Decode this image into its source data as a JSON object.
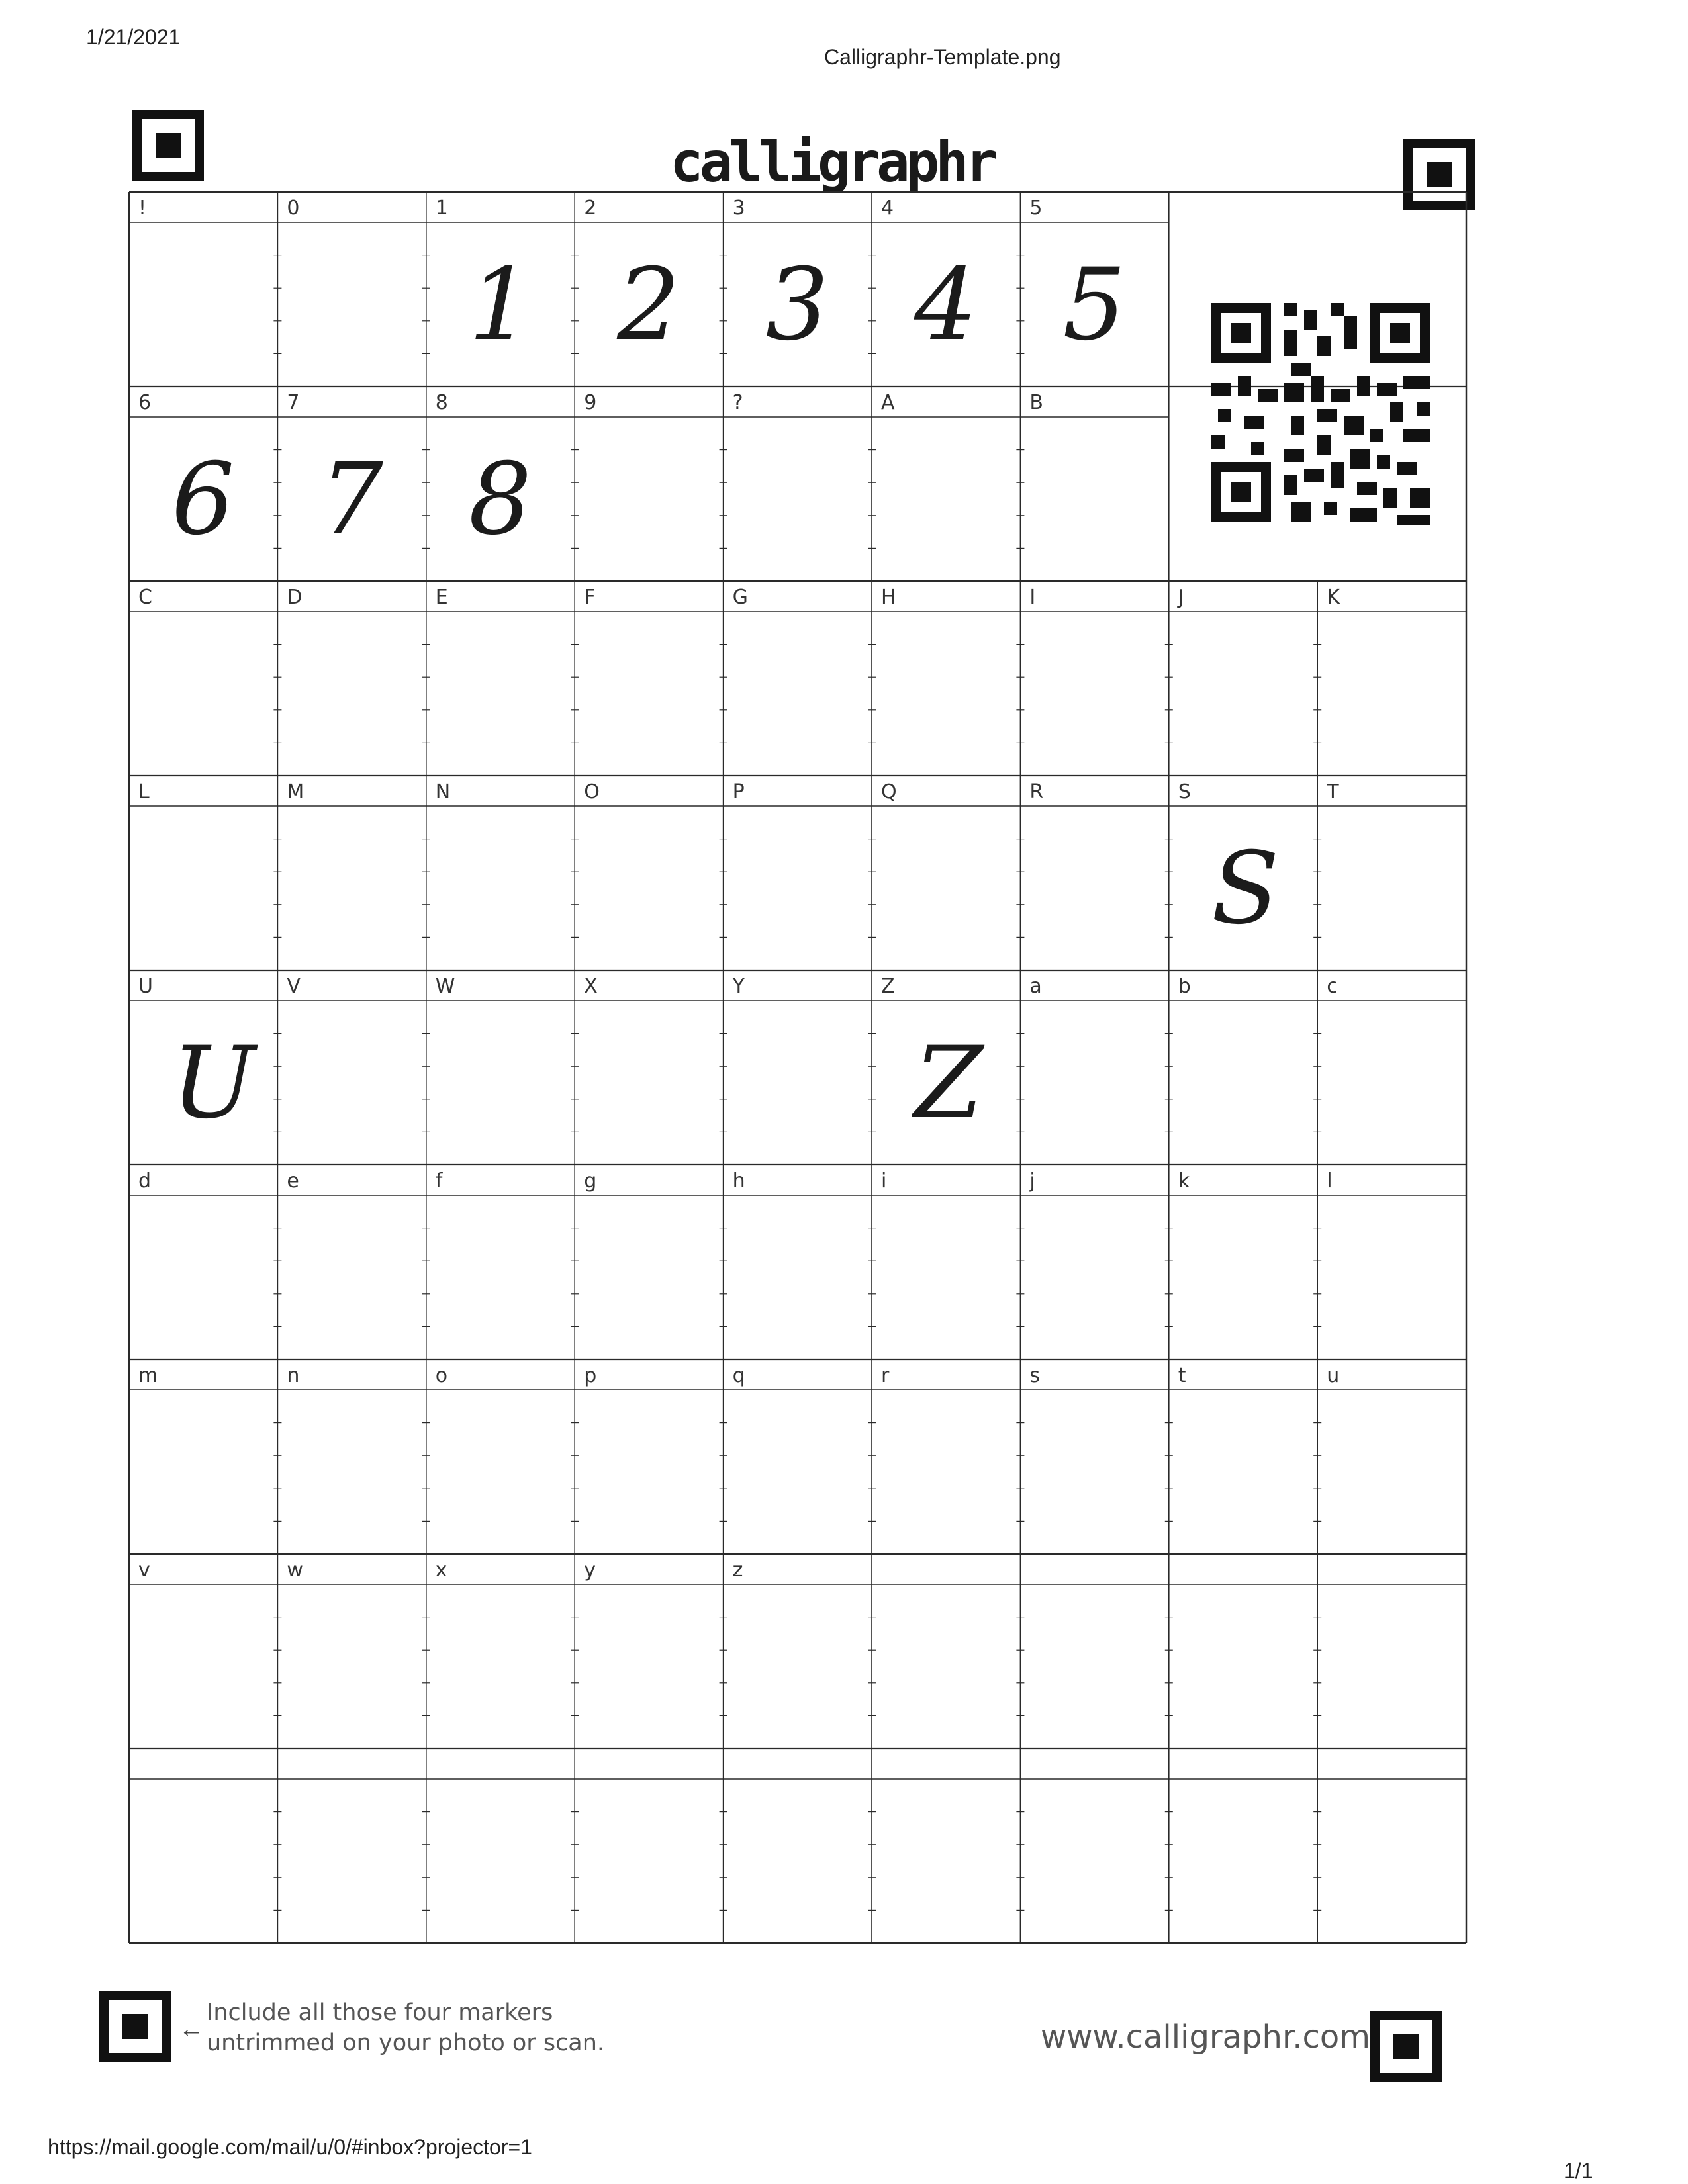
{
  "print_header": {
    "date": "1/21/2021",
    "title": "Calligraphr-Template.png",
    "url": "https://mail.google.com/mail/u/0/#inbox?projector=1",
    "page_count": "1/1"
  },
  "template": {
    "logo_text": "calligraphr",
    "rows": [
      {
        "cells": [
          {
            "label": "!",
            "glyph": ""
          },
          {
            "label": "0",
            "glyph": ""
          },
          {
            "label": "1",
            "glyph": "1"
          },
          {
            "label": "2",
            "glyph": "2"
          },
          {
            "label": "3",
            "glyph": "3"
          },
          {
            "label": "4",
            "glyph": "4"
          },
          {
            "label": "5",
            "glyph": "5"
          }
        ]
      },
      {
        "cells": [
          {
            "label": "6",
            "glyph": "6"
          },
          {
            "label": "7",
            "glyph": "7"
          },
          {
            "label": "8",
            "glyph": "8"
          },
          {
            "label": "9",
            "glyph": ""
          },
          {
            "label": "?",
            "glyph": ""
          },
          {
            "label": "A",
            "glyph": ""
          },
          {
            "label": "B",
            "glyph": ""
          }
        ]
      },
      {
        "cells": [
          {
            "label": "C",
            "glyph": ""
          },
          {
            "label": "D",
            "glyph": ""
          },
          {
            "label": "E",
            "glyph": ""
          },
          {
            "label": "F",
            "glyph": ""
          },
          {
            "label": "G",
            "glyph": ""
          },
          {
            "label": "H",
            "glyph": ""
          },
          {
            "label": "I",
            "glyph": ""
          },
          {
            "label": "J",
            "glyph": ""
          },
          {
            "label": "K",
            "glyph": ""
          }
        ]
      },
      {
        "cells": [
          {
            "label": "L",
            "glyph": ""
          },
          {
            "label": "M",
            "glyph": ""
          },
          {
            "label": "N",
            "glyph": ""
          },
          {
            "label": "O",
            "glyph": ""
          },
          {
            "label": "P",
            "glyph": ""
          },
          {
            "label": "Q",
            "glyph": ""
          },
          {
            "label": "R",
            "glyph": ""
          },
          {
            "label": "S",
            "glyph": "S"
          },
          {
            "label": "T",
            "glyph": ""
          }
        ]
      },
      {
        "cells": [
          {
            "label": "U",
            "glyph": "U"
          },
          {
            "label": "V",
            "glyph": ""
          },
          {
            "label": "W",
            "glyph": ""
          },
          {
            "label": "X",
            "glyph": ""
          },
          {
            "label": "Y",
            "glyph": ""
          },
          {
            "label": "Z",
            "glyph": "Z"
          },
          {
            "label": "a",
            "glyph": ""
          },
          {
            "label": "b",
            "glyph": ""
          },
          {
            "label": "c",
            "glyph": ""
          }
        ]
      },
      {
        "cells": [
          {
            "label": "d",
            "glyph": ""
          },
          {
            "label": "e",
            "glyph": ""
          },
          {
            "label": "f",
            "glyph": ""
          },
          {
            "label": "g",
            "glyph": ""
          },
          {
            "label": "h",
            "glyph": ""
          },
          {
            "label": "i",
            "glyph": ""
          },
          {
            "label": "j",
            "glyph": ""
          },
          {
            "label": "k",
            "glyph": ""
          },
          {
            "label": "l",
            "glyph": ""
          }
        ]
      },
      {
        "cells": [
          {
            "label": "m",
            "glyph": ""
          },
          {
            "label": "n",
            "glyph": ""
          },
          {
            "label": "o",
            "glyph": ""
          },
          {
            "label": "p",
            "glyph": ""
          },
          {
            "label": "q",
            "glyph": ""
          },
          {
            "label": "r",
            "glyph": ""
          },
          {
            "label": "s",
            "glyph": ""
          },
          {
            "label": "t",
            "glyph": ""
          },
          {
            "label": "u",
            "glyph": ""
          }
        ]
      },
      {
        "cells": [
          {
            "label": "v",
            "glyph": ""
          },
          {
            "label": "w",
            "glyph": ""
          },
          {
            "label": "x",
            "glyph": ""
          },
          {
            "label": "y",
            "glyph": ""
          },
          {
            "label": "z",
            "glyph": ""
          },
          {
            "label": "",
            "glyph": ""
          },
          {
            "label": "",
            "glyph": ""
          },
          {
            "label": "",
            "glyph": ""
          },
          {
            "label": "",
            "glyph": ""
          }
        ]
      },
      {
        "cells": [
          {
            "label": "",
            "glyph": ""
          },
          {
            "label": "",
            "glyph": ""
          },
          {
            "label": "",
            "glyph": ""
          },
          {
            "label": "",
            "glyph": ""
          },
          {
            "label": "",
            "glyph": ""
          },
          {
            "label": "",
            "glyph": ""
          },
          {
            "label": "",
            "glyph": ""
          },
          {
            "label": "",
            "glyph": ""
          },
          {
            "label": "",
            "glyph": ""
          }
        ]
      }
    ],
    "footer_note_line1": "Include all those four markers",
    "footer_note_line2": "untrimmed on your photo or scan.",
    "footer_arrow": "←",
    "website": "www.calligraphr.com"
  },
  "colors": {
    "ink": "#1b1b1b",
    "grid": "#2a2a2a",
    "paper": "#ffffff"
  },
  "icons": [
    "corner-marker-icon",
    "qr-code-icon",
    "left-arrow-icon"
  ]
}
